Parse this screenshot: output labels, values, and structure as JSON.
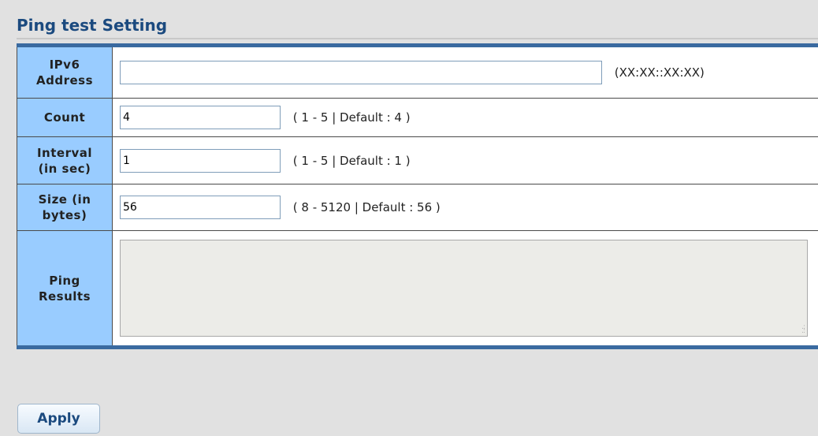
{
  "section": {
    "title": "Ping test Setting"
  },
  "fields": {
    "ipv6": {
      "label_line1": "IPv6",
      "label_line2": "Address",
      "value": "",
      "hint": "(XX:XX::XX:XX)"
    },
    "count": {
      "label": "Count",
      "value": "4",
      "hint": "( 1 - 5 | Default : 4 )"
    },
    "interval": {
      "label_line1": "Interval",
      "label_line2": "(in sec)",
      "value": "1",
      "hint": "( 1 - 5 | Default : 1 )"
    },
    "size": {
      "label_line1": "Size (in",
      "label_line2": "bytes)",
      "value": "56",
      "hint": "( 8 - 5120 | Default : 56 )"
    },
    "results": {
      "label_line1": "Ping",
      "label_line2": "Results",
      "value": ""
    }
  },
  "actions": {
    "apply_label": "Apply"
  },
  "colors": {
    "title": "#1b4a7f",
    "label_bg": "#99ccff",
    "table_rule": "#3a6aa0",
    "page_bg": "#e1e1e1"
  }
}
